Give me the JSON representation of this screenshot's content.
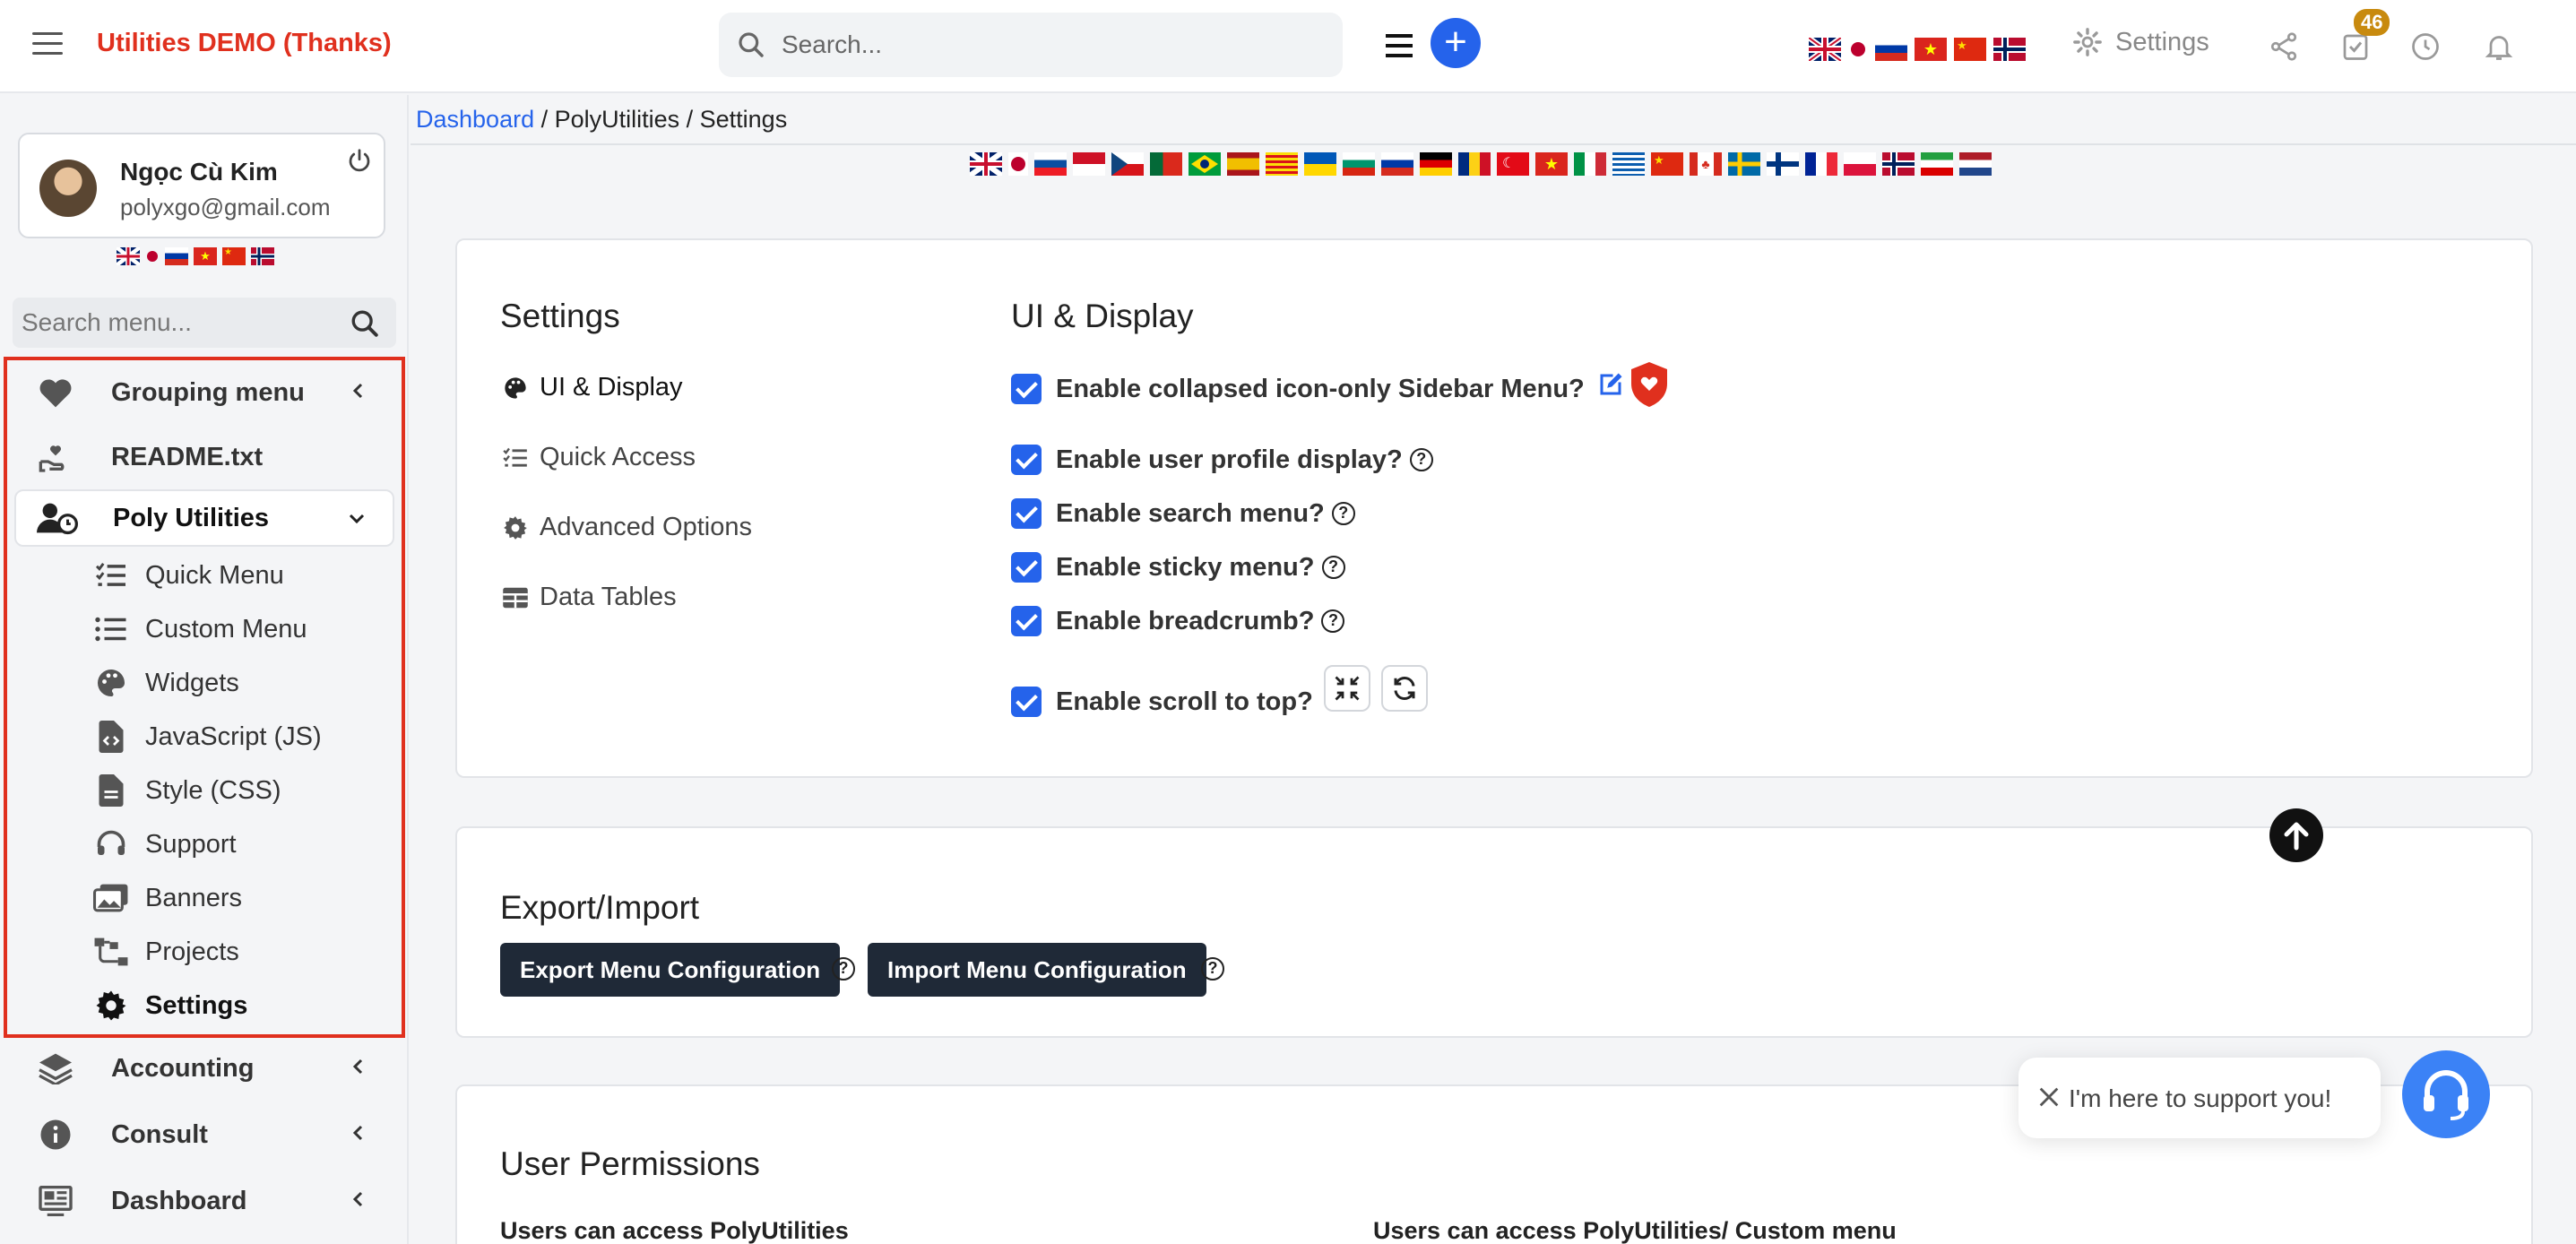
{
  "header": {
    "brand": "Utilities DEMO (Thanks)",
    "search_placeholder": "Search...",
    "settings_label": "Settings",
    "notification_count": "46",
    "flags": [
      "uk",
      "jp",
      "ru",
      "vn",
      "cn",
      "no"
    ]
  },
  "sidebar": {
    "user_name": "Ngọc Cù Kim",
    "user_email": "polyxgo@gmail.com",
    "search_placeholder": "Search menu...",
    "items": [
      {
        "label": "Grouping menu",
        "icon": "heart-icon"
      },
      {
        "label": "README.txt",
        "icon": "hand-heart-icon"
      },
      {
        "label": "Poly Utilities",
        "icon": "user-clock-icon"
      }
    ],
    "submenu": [
      {
        "label": "Quick Menu",
        "icon": "list-check-icon"
      },
      {
        "label": "Custom Menu",
        "icon": "list-icon"
      },
      {
        "label": "Widgets",
        "icon": "palette-icon"
      },
      {
        "label": "JavaScript (JS)",
        "icon": "file-code-icon"
      },
      {
        "label": "Style (CSS)",
        "icon": "file-icon"
      },
      {
        "label": "Support",
        "icon": "headset-icon"
      },
      {
        "label": "Banners",
        "icon": "images-icon"
      },
      {
        "label": "Projects",
        "icon": "diagram-icon"
      },
      {
        "label": "Settings",
        "icon": "gear-icon"
      }
    ],
    "bottom_items": [
      {
        "label": "Accounting",
        "icon": "layers-icon"
      },
      {
        "label": "Consult",
        "icon": "info-icon"
      },
      {
        "label": "Dashboard",
        "icon": "dashboard-icon"
      }
    ]
  },
  "breadcrumb": {
    "link": "Dashboard",
    "rest": " / PolyUtilities / Settings"
  },
  "settings_card": {
    "title": "Settings",
    "nav": [
      {
        "label": "UI & Display",
        "icon": "palette-icon"
      },
      {
        "label": "Quick Access",
        "icon": "list-check-icon"
      },
      {
        "label": "Advanced Options",
        "icon": "gear-icon"
      },
      {
        "label": "Data Tables",
        "icon": "table-icon"
      }
    ],
    "section_title": "UI & Display",
    "options": [
      {
        "label": "Enable collapsed icon-only Sidebar Menu?",
        "checked": true
      },
      {
        "label": "Enable user profile display?",
        "checked": true
      },
      {
        "label": "Enable search menu?",
        "checked": true
      },
      {
        "label": "Enable sticky menu?",
        "checked": true
      },
      {
        "label": "Enable breadcrumb?",
        "checked": true
      },
      {
        "label": "Enable scroll to top?",
        "checked": true
      }
    ]
  },
  "export_card": {
    "title": "Export/Import",
    "export_button": "Export Menu Configuration",
    "import_button": "Import Menu Configuration"
  },
  "permissions_card": {
    "title": "User Permissions",
    "col1": "Users can access PolyUtilities",
    "col2": "Users can access PolyUtilities/ Custom menu"
  },
  "support": {
    "message": "I'm here to support you!"
  },
  "colors": {
    "brand": "#e0301e",
    "accent": "#2563eb",
    "dark_button": "#1f2937",
    "badge": "#c88a0e"
  }
}
